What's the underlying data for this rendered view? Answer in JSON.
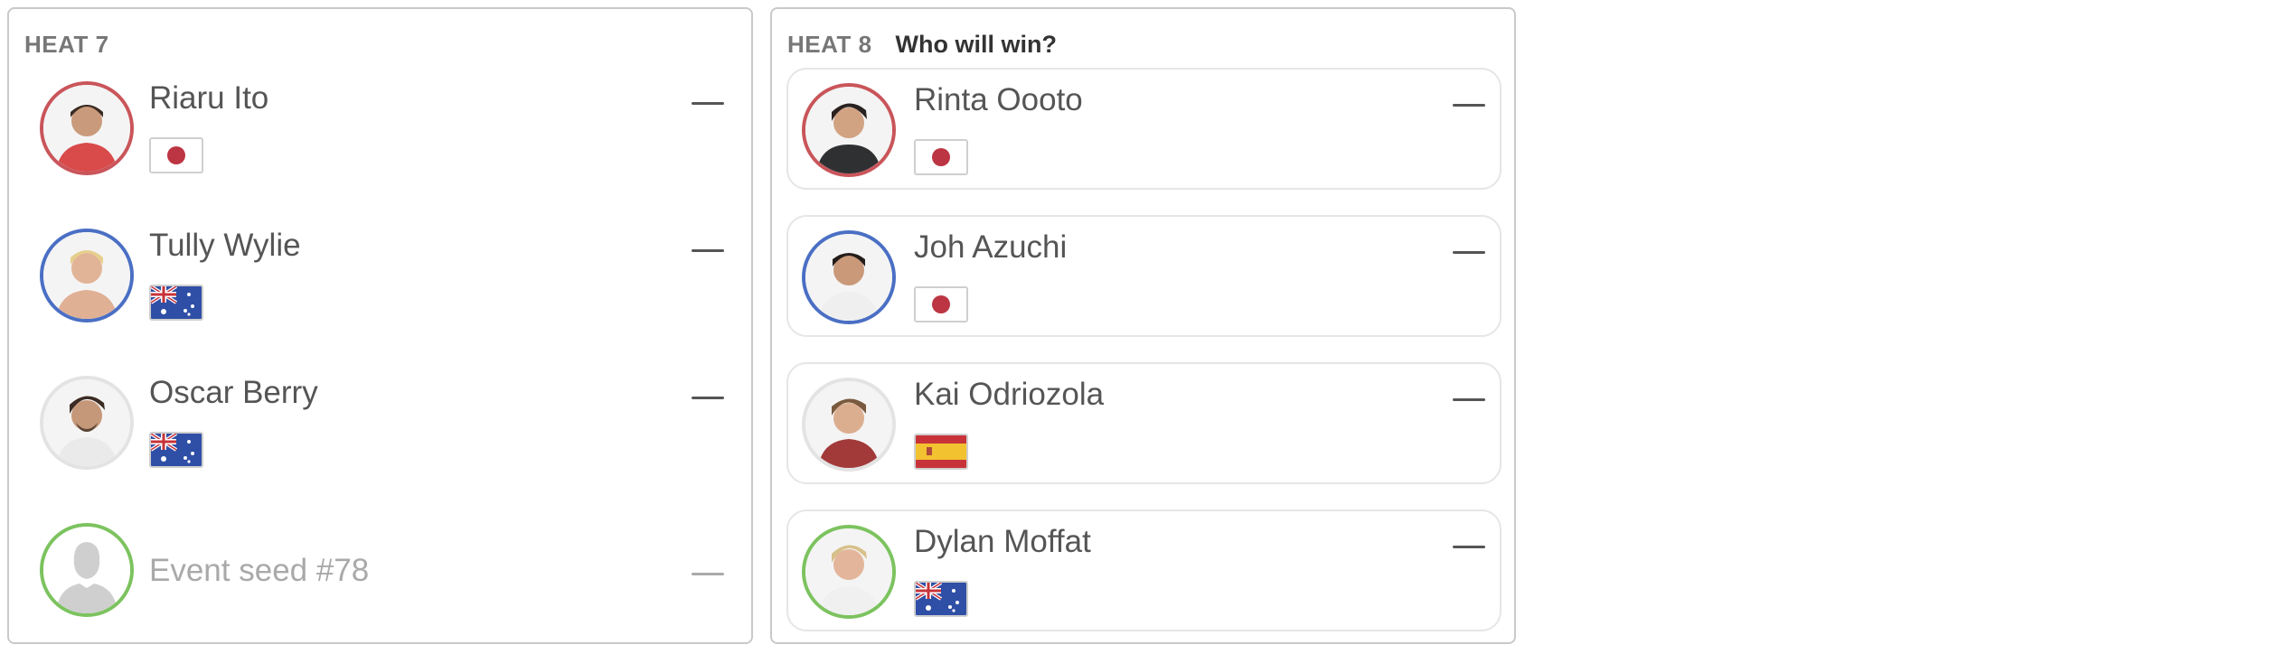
{
  "colors": {
    "red_ring": "#c9555a",
    "blue_ring": "#4a6fc4",
    "white_ring": "#e3e3e3",
    "green_ring": "#7cc35f",
    "japan_red": "#bc3543",
    "aus_blue": "#2f4fa6",
    "spain_red": "#c8333a",
    "spain_yellow": "#f2c230"
  },
  "heats": [
    {
      "label": "HEAT 7",
      "prompt": "",
      "surfers": [
        {
          "name": "Riaru Ito",
          "flag": "japan-flag-icon",
          "ring": "red",
          "placeholder": false
        },
        {
          "name": "Tully Wylie",
          "flag": "australia-flag-icon",
          "ring": "blue",
          "placeholder": false
        },
        {
          "name": "Oscar Berry",
          "flag": "australia-flag-icon",
          "ring": "white",
          "placeholder": false
        },
        {
          "name": "Event seed #78",
          "flag": "",
          "ring": "green",
          "placeholder": true
        }
      ]
    },
    {
      "label": "HEAT 8",
      "prompt": "Who will win?",
      "surfers": [
        {
          "name": "Rinta Oooto",
          "flag": "japan-flag-icon",
          "ring": "red",
          "placeholder": false
        },
        {
          "name": "Joh Azuchi",
          "flag": "japan-flag-icon",
          "ring": "blue",
          "placeholder": false
        },
        {
          "name": "Kai Odriozola",
          "flag": "spain-flag-icon",
          "ring": "white",
          "placeholder": false
        },
        {
          "name": "Dylan Moffat",
          "flag": "australia-flag-icon",
          "ring": "green",
          "placeholder": false
        }
      ]
    }
  ]
}
